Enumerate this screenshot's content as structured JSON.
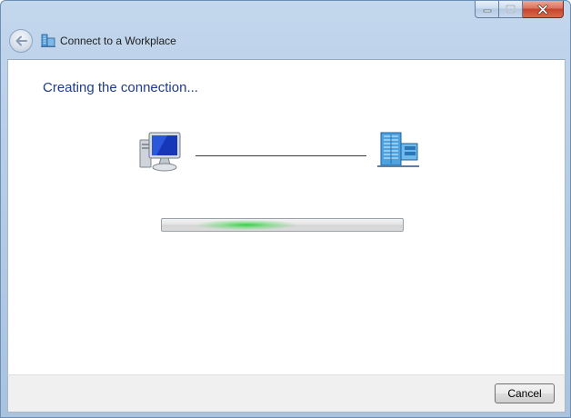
{
  "window": {
    "title": "Connect to a Workplace",
    "caption_buttons": [
      "minimize",
      "maximize",
      "close"
    ]
  },
  "header": {
    "back_icon": "back-arrow-icon",
    "app_icon": "workplace-icon"
  },
  "main": {
    "heading": "Creating the connection...",
    "local_icon": "computer-icon",
    "remote_icon": "workplace-server-icon",
    "progress": {
      "style": "indeterminate-marquee",
      "glow_color": "#2fd43c"
    }
  },
  "footer": {
    "cancel_label": "Cancel"
  },
  "colors": {
    "heading": "#1e3c8c",
    "frame": "#b6cde6",
    "close_button": "#c7432b"
  }
}
